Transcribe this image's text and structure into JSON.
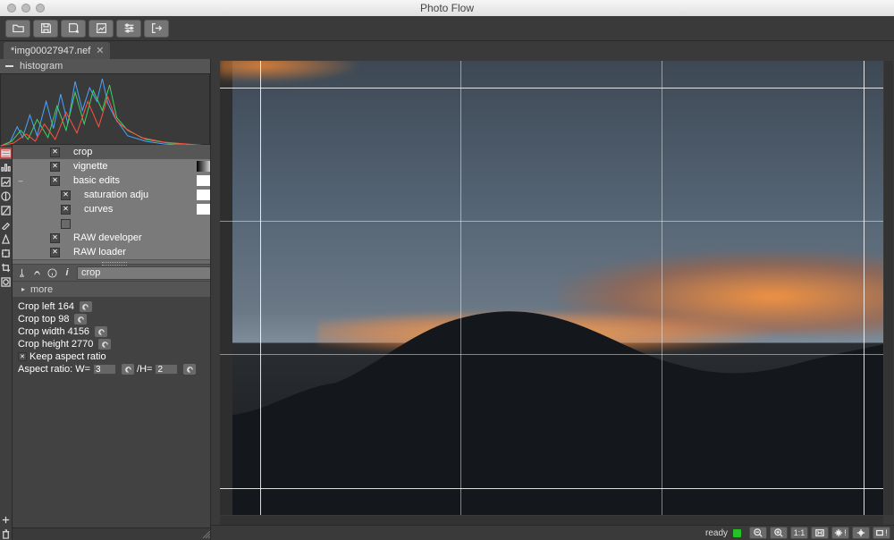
{
  "app": {
    "title": "Photo Flow"
  },
  "document": {
    "filename": "*img00027947.nef"
  },
  "toolbar": {
    "items": [
      "open",
      "save",
      "save-as",
      "export-image",
      "settings",
      "exit"
    ]
  },
  "panels": {
    "histogram": {
      "title": "histogram"
    }
  },
  "layers": {
    "items": [
      {
        "id": "crop",
        "name": "crop",
        "visible": true,
        "selected": true,
        "swatch": null,
        "indent": 0
      },
      {
        "id": "vignette",
        "name": "vignette",
        "visible": true,
        "selected": false,
        "swatch": "grad",
        "indent": 0
      },
      {
        "id": "basic",
        "name": "basic edits",
        "visible": true,
        "selected": false,
        "swatch": "white",
        "indent": 0,
        "collapsible": true
      },
      {
        "id": "sat",
        "name": "saturation adju",
        "visible": true,
        "selected": false,
        "swatch": "white",
        "indent": 1
      },
      {
        "id": "curves",
        "name": "curves",
        "visible": true,
        "selected": false,
        "swatch": "white",
        "indent": 1
      },
      {
        "id": "blank",
        "name": "",
        "visible": false,
        "selected": false,
        "swatch": null,
        "indent": 1,
        "blank": true
      },
      {
        "id": "rawdev",
        "name": "RAW developer",
        "visible": true,
        "selected": false,
        "swatch": null,
        "indent": 0
      },
      {
        "id": "rawload",
        "name": "RAW loader",
        "visible": true,
        "selected": false,
        "swatch": null,
        "indent": 0
      }
    ]
  },
  "section": {
    "name_value": "crop",
    "more_label": "more"
  },
  "crop_props": {
    "left_label": "Crop left",
    "left_value": "164",
    "top_label": "Crop top",
    "top_value": "98",
    "width_label": "Crop width",
    "width_value": "4156",
    "height_label": "Crop height",
    "height_value": "2770",
    "keep_ratio_label": "Keep aspect ratio",
    "keep_ratio_checked": true,
    "aspect_label": "Aspect ratio: W=",
    "aspect_w": "3",
    "aspect_sep": "/H=",
    "aspect_h": "2"
  },
  "status": {
    "ready": "ready",
    "zoom_label": "1:1"
  },
  "status_buttons": [
    "zoom-out",
    "zoom-in",
    "zoom-1-1",
    "zoom-fit",
    "highlight-warning",
    "softproof",
    "shadow-warning"
  ],
  "chart_data": null
}
